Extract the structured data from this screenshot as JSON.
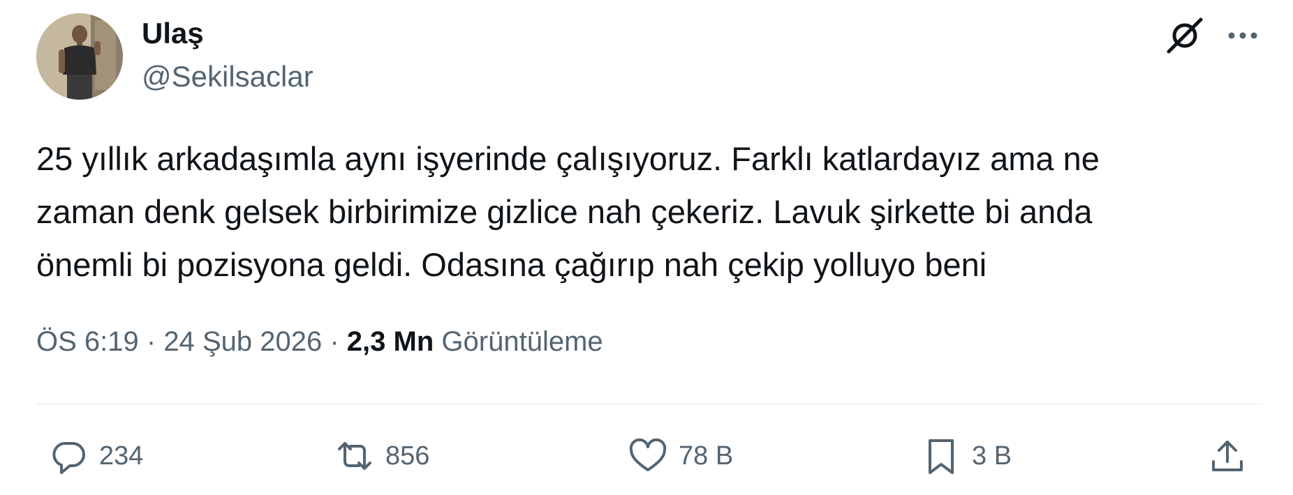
{
  "author": {
    "display_name": "Ulaş",
    "handle": "@Sekilsaclar"
  },
  "header_icons": {
    "grok": "grok-icon",
    "more": "more-icon"
  },
  "tweet": {
    "text_lines": [
      "25 yıllık arkadaşımla aynı işyerinde çalışıyoruz. Farklı katlardayız ama ne",
      "zaman denk gelsek birbirimize gizlice nah çekeriz. Lavuk şirkette bi anda",
      "önemli bi pozisyona geldi. Odasına çağırıp nah çekip yolluyo beni"
    ]
  },
  "meta": {
    "time": "ÖS 6:19",
    "separator": "·",
    "date": "24 Şub 2026",
    "views_count": "2,3 Mn",
    "views_label": "Görüntüleme"
  },
  "actions": {
    "reply": {
      "icon": "reply-icon",
      "count": "234"
    },
    "retweet": {
      "icon": "retweet-icon",
      "count": "856"
    },
    "like": {
      "icon": "heart-icon",
      "count": "78 B"
    },
    "bookmark": {
      "icon": "bookmark-icon",
      "count": "3 B"
    },
    "share": {
      "icon": "share-icon"
    }
  },
  "colors": {
    "text_primary": "#0f1419",
    "text_secondary": "#536471",
    "divider": "#eff3f4",
    "background": "#ffffff"
  }
}
